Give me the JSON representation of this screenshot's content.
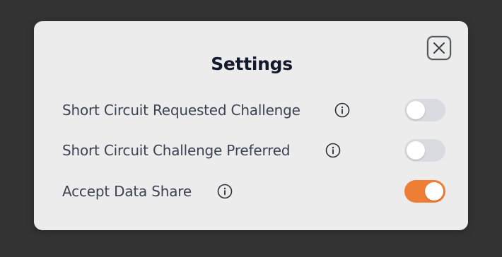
{
  "dialog": {
    "title": "Settings",
    "close_icon": "close-icon"
  },
  "settings": [
    {
      "label": "Short Circuit Requested Challenge",
      "info_icon": "info-icon",
      "enabled": false
    },
    {
      "label": "Short Circuit Challenge Preferred",
      "info_icon": "info-icon",
      "enabled": false
    },
    {
      "label": "Accept Data Share",
      "info_icon": "info-icon",
      "enabled": true
    }
  ],
  "colors": {
    "toggle_on": "#ef7e35",
    "toggle_off": "#d9dbe0",
    "dialog_bg": "#ececec",
    "backdrop": "#333333"
  }
}
